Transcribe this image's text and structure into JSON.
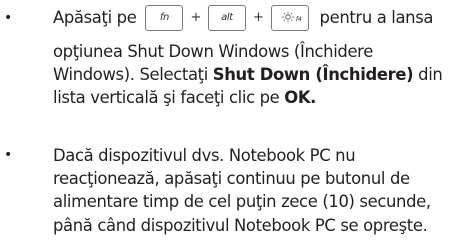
{
  "item1": {
    "bullet": "•",
    "prefix": "Apăsaţi pe",
    "key_fn": "fn",
    "key_alt": "alt",
    "key_f4": "f4",
    "plus": "+",
    "suffix": "pentru a lansa",
    "line2": "opţiunea Shut Down Windows (Închidere",
    "line3_a": "Windows). Selectaţi ",
    "line3_b": "Shut Down (Închidere)",
    "line3_c": " din",
    "line4_a": "lista verticală şi faceţi clic pe ",
    "line4_b": "OK."
  },
  "item2": {
    "bullet": "•",
    "lines": [
      "Dacă dispozitivul dvs. Notebook PC nu",
      "reacţionează, apăsaţi continuu pe butonul de",
      "alimentare timp de cel puţin zece (10) secunde,",
      "până când dispozitivul Notebook PC se opreşte."
    ]
  }
}
